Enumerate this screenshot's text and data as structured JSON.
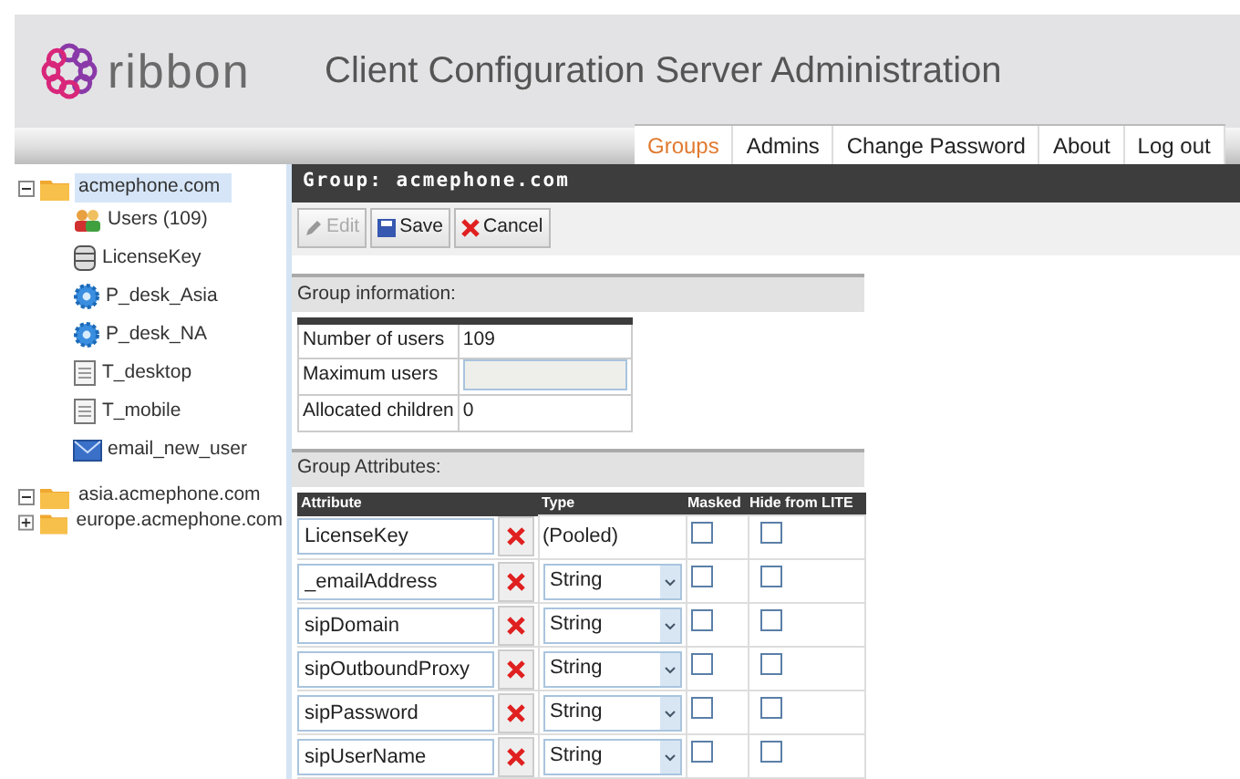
{
  "header": {
    "logo": "ribbon",
    "title": "Client Configuration Server Administration"
  },
  "nav": [
    {
      "label": "Groups",
      "selected": true
    },
    {
      "label": "Admins",
      "selected": false
    },
    {
      "label": "Change Password",
      "selected": false
    },
    {
      "label": "About",
      "selected": false
    },
    {
      "label": "Log out",
      "selected": false
    }
  ],
  "tree": [
    {
      "label": "acmephone.com",
      "expanded": true,
      "selected": true,
      "children": [
        {
          "label": "Users (109)",
          "kind": "users"
        },
        {
          "label": "LicenseKey",
          "kind": "database"
        },
        {
          "label": "P_desk_Asia",
          "kind": "gear"
        },
        {
          "label": "P_desk_NA",
          "kind": "gear"
        },
        {
          "label": "T_desktop",
          "kind": "document"
        },
        {
          "label": "T_mobile",
          "kind": "document"
        },
        {
          "label": "email_new_user",
          "kind": "email"
        }
      ]
    },
    {
      "label": "asia.acmephone.com",
      "expanded": true,
      "selected": false
    },
    {
      "label": "europe.acmephone.com",
      "expanded": false,
      "selected": false
    }
  ],
  "group": {
    "title": "Group: acmephone.com",
    "toolbar": [
      {
        "label": "Edit",
        "kind": "edit",
        "disabled": true
      },
      {
        "label": "Save",
        "kind": "save",
        "disabled": false
      },
      {
        "label": "Cancel",
        "kind": "cancel",
        "disabled": false
      }
    ],
    "info_heading": "Group information:",
    "info": [
      {
        "label": "Number of users",
        "value": "109",
        "kind": "text"
      },
      {
        "label": "Maximum users",
        "kind": "field"
      },
      {
        "label": "Allocated children",
        "value": "0",
        "kind": "text"
      }
    ],
    "attributes_heading": "Group Attributes:",
    "columns": [
      "Attribute",
      "Type",
      "Masked",
      "Hide from LITE"
    ],
    "attributes": [
      {
        "name": "LicenseKey",
        "type": "(Pooled)",
        "kind": "fixed",
        "masked": false,
        "hidden": false
      },
      {
        "name": "_emailAddress",
        "type": "String",
        "kind": "select",
        "masked": false,
        "hidden": false
      },
      {
        "name": "sipDomain",
        "type": "String",
        "kind": "select",
        "masked": false,
        "hidden": false
      },
      {
        "name": "sipOutboundProxy",
        "type": "String",
        "kind": "select",
        "masked": false,
        "hidden": false
      },
      {
        "name": "sipPassword",
        "type": "String",
        "kind": "select",
        "masked": false,
        "hidden": false
      },
      {
        "name": "sipUserName",
        "type": "String",
        "kind": "select",
        "masked": false,
        "hidden": false
      }
    ]
  }
}
